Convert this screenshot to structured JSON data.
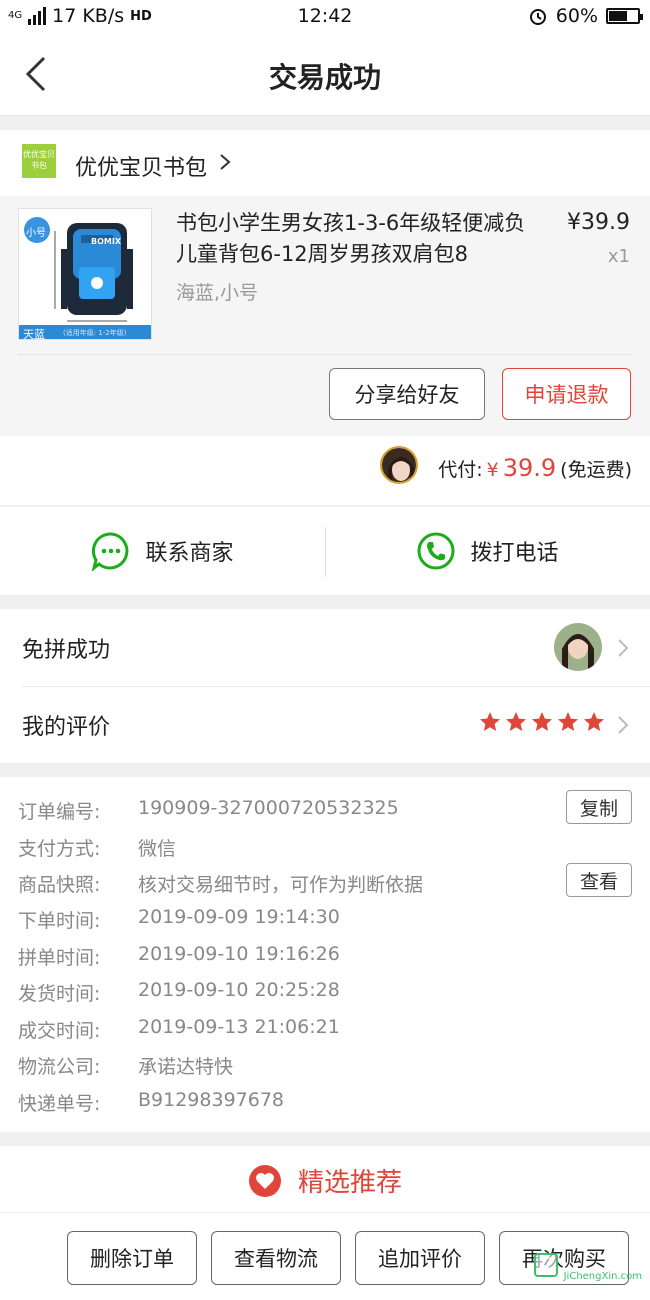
{
  "status_bar": {
    "network": "4G",
    "speed": "17 KB/s",
    "hd": "HD",
    "time": "12:42",
    "battery": "60%"
  },
  "nav": {
    "title": "交易成功"
  },
  "shop": {
    "logo_text": "优优宝贝书包",
    "name": "优优宝贝书包"
  },
  "product": {
    "title": "书包小学生男女孩1-3-6年级轻便减负儿童背包6-12周岁男孩双肩包8",
    "spec": "海蓝,小号",
    "price": "¥39.9",
    "qty": "x1",
    "image": {
      "size_tag": "小号",
      "color_tag": "天蓝",
      "grade_tag": "(适用年级: 1-2年级)",
      "brand": "BOMIX"
    },
    "share_label": "分享给好友",
    "refund_label": "申请退款"
  },
  "payment": {
    "label": "代付:",
    "currency": "¥",
    "amount": "39.9",
    "note": "(免运费)"
  },
  "contact": {
    "merchant_label": "联系商家",
    "call_label": "拨打电话"
  },
  "group": {
    "label": "免拼成功"
  },
  "review": {
    "label": "我的评价",
    "stars": 5
  },
  "details": {
    "order_no": {
      "key": "订单编号:",
      "value": "190909-327000720532325",
      "action": "复制"
    },
    "pay_method": {
      "key": "支付方式:",
      "value": "微信"
    },
    "snapshot": {
      "key": "商品快照:",
      "value": "核对交易细节时，可作为判断依据",
      "action": "查看"
    },
    "order_time": {
      "key": "下单时间:",
      "value": "2019-09-09 19:14:30"
    },
    "group_time": {
      "key": "拼单时间:",
      "value": "2019-09-10 19:16:26"
    },
    "ship_time": {
      "key": "发货时间:",
      "value": "2019-09-10 20:25:28"
    },
    "deal_time": {
      "key": "成交时间:",
      "value": "2019-09-13 21:06:21"
    },
    "logistics": {
      "key": "物流公司:",
      "value": "承诺达特快"
    },
    "tracking": {
      "key": "快递单号:",
      "value": "B91298397678"
    }
  },
  "recommend": {
    "label": "精选推荐"
  },
  "actions": {
    "delete": "删除订单",
    "logistics": "查看物流",
    "add_review": "追加评价",
    "rebuy": "再次购买"
  },
  "watermark": {
    "text": "JiChengXin.com"
  },
  "colors": {
    "accent": "#e0453a",
    "green": "#1aad19",
    "star": "#e0453a"
  }
}
